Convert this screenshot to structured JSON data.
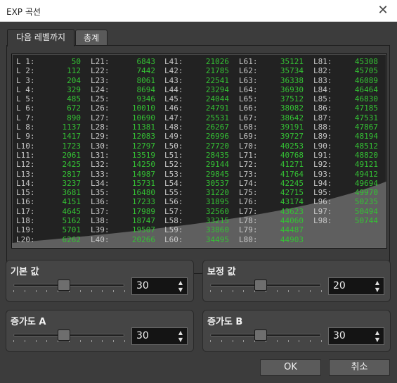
{
  "window": {
    "title": "EXP 곡선",
    "close_icon": "close-icon"
  },
  "tabs": [
    {
      "label": "다음 레벨까지"
    },
    {
      "label": "총계"
    }
  ],
  "colors": {
    "value": "#34c234",
    "level": "#c8c8c8",
    "curve_fill": "#6a6a6a"
  },
  "columns": [
    {
      "levels": [
        "L 1:",
        "L 2:",
        "L 3:",
        "L 4:",
        "L 5:",
        "L 6:",
        "L 7:",
        "L 8:",
        "L 9:",
        "L10:",
        "L11:",
        "L12:",
        "L13:",
        "L14:",
        "L15:",
        "L16:",
        "L17:",
        "L18:",
        "L19:",
        "L20:"
      ],
      "values": [
        "50",
        "112",
        "204",
        "329",
        "485",
        "672",
        "890",
        "1137",
        "1417",
        "1723",
        "2061",
        "2425",
        "2817",
        "3237",
        "3681",
        "4151",
        "4645",
        "5162",
        "5701",
        "6262"
      ]
    },
    {
      "levels": [
        "L21:",
        "L22:",
        "L23:",
        "L24:",
        "L25:",
        "L26:",
        "L27:",
        "L28:",
        "L29:",
        "L30:",
        "L31:",
        "L32:",
        "L33:",
        "L34:",
        "L35:",
        "L36:",
        "L37:",
        "L38:",
        "L39:",
        "L40:"
      ],
      "values": [
        "6843",
        "7442",
        "8061",
        "8694",
        "9346",
        "10010",
        "10690",
        "11381",
        "12083",
        "12797",
        "13519",
        "14250",
        "14987",
        "15731",
        "16480",
        "17233",
        "17989",
        "18747",
        "19507",
        "20266"
      ]
    },
    {
      "levels": [
        "L41:",
        "L42:",
        "L43:",
        "L44:",
        "L45:",
        "L46:",
        "L47:",
        "L48:",
        "L49:",
        "L50:",
        "L51:",
        "L52:",
        "L53:",
        "L54:",
        "L55:",
        "L56:",
        "L57:",
        "L58:",
        "L59:",
        "L60:"
      ],
      "values": [
        "21026",
        "21785",
        "22541",
        "23294",
        "24044",
        "24791",
        "25531",
        "26267",
        "26996",
        "27720",
        "28435",
        "29144",
        "29845",
        "30537",
        "31220",
        "31895",
        "32560",
        "33215",
        "33860",
        "34495"
      ]
    },
    {
      "levels": [
        "L61:",
        "L62:",
        "L63:",
        "L64:",
        "L65:",
        "L66:",
        "L67:",
        "L68:",
        "L69:",
        "L70:",
        "L71:",
        "L72:",
        "L73:",
        "L74:",
        "L75:",
        "L76:",
        "L77:",
        "L78:",
        "L79:",
        "L80:"
      ],
      "values": [
        "35121",
        "35734",
        "36338",
        "36930",
        "37512",
        "38082",
        "38642",
        "39191",
        "39727",
        "40253",
        "40768",
        "41271",
        "41764",
        "42245",
        "42715",
        "43174",
        "43623",
        "44060",
        "44487",
        "44903"
      ]
    },
    {
      "levels": [
        "L81:",
        "L82:",
        "L83:",
        "L84:",
        "L85:",
        "L86:",
        "L87:",
        "L88:",
        "L89:",
        "L90:",
        "L91:",
        "L92:",
        "L93:",
        "L94:",
        "L95:",
        "L96:",
        "L97:",
        "L98:"
      ],
      "values": [
        "45308",
        "45705",
        "46089",
        "46464",
        "46830",
        "47185",
        "47531",
        "47867",
        "48194",
        "48512",
        "48820",
        "49121",
        "49412",
        "49694",
        "49970",
        "50235",
        "50494",
        "50744"
      ]
    }
  ],
  "groups": {
    "base": {
      "label": "기본 값",
      "value": "30",
      "slider_fraction": 0.45
    },
    "correction": {
      "label": "보정 값",
      "value": "20",
      "slider_fraction": 0.45
    },
    "accel_a": {
      "label": "증가도 A",
      "value": "30",
      "slider_fraction": 0.45
    },
    "accel_b": {
      "label": "증가도 B",
      "value": "30",
      "slider_fraction": 0.45
    }
  },
  "buttons": {
    "ok": "OK",
    "cancel": "취소"
  },
  "spin_icons": {
    "up": "▲",
    "down": "▼"
  }
}
